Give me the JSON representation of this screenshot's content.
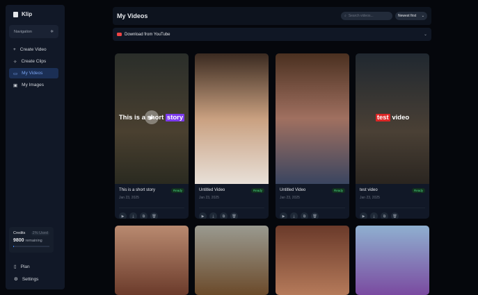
{
  "sidebar": {
    "app_name": "Klip",
    "navigation_label": "Navigation",
    "items": [
      {
        "label": "Create Video",
        "icon": "plus-icon"
      },
      {
        "label": "Create Clips",
        "icon": "sparkle-icon"
      },
      {
        "label": "My Videos",
        "icon": "video-icon"
      },
      {
        "label": "My Images",
        "icon": "image-icon"
      }
    ],
    "credits": {
      "label": "Credits",
      "used": "2% Used",
      "amount": "9800",
      "remaining": "remaining",
      "used_percent": 2
    },
    "plan": "Plan",
    "settings": "Settings"
  },
  "header": {
    "title": "My Videos",
    "search_placeholder": "Search videos...",
    "sort": "Newest first"
  },
  "youtube": {
    "label": "Download from YouTube"
  },
  "videos": [
    {
      "title": "This is a short story",
      "date": "Jan 23, 2025",
      "status": "Ready",
      "overlay": "This is a short",
      "overlay_hl": "story"
    },
    {
      "title": "Untitled Video",
      "date": "Jan 23, 2025",
      "status": "Ready"
    },
    {
      "title": "Untitled Video",
      "date": "Jan 23, 2025",
      "status": "Ready"
    },
    {
      "title": "test video",
      "date": "Jan 23, 2025",
      "status": "Ready",
      "overlay_hl": "test",
      "overlay": "video"
    }
  ]
}
